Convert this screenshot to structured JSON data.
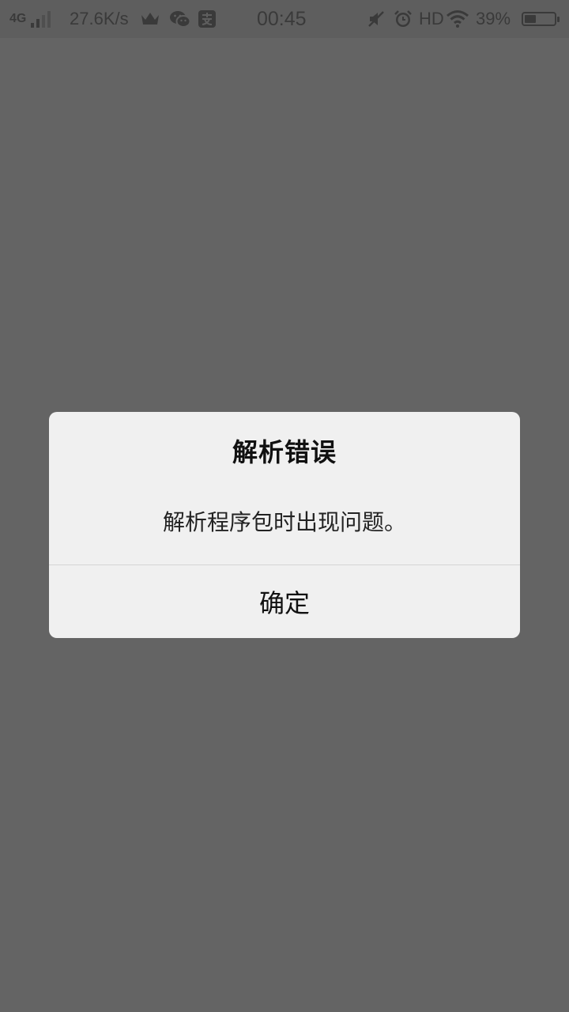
{
  "status_bar": {
    "network": "4G",
    "speed": "27.6K/s",
    "time": "00:45",
    "hd": "HD",
    "battery_percent": "39%",
    "battery_level": 0.39,
    "icons": [
      "signal-icon",
      "crown-icon",
      "wechat-icon",
      "alipay-icon",
      "mute-icon",
      "alarm-icon",
      "wifi-icon",
      "battery-icon"
    ]
  },
  "dialog": {
    "title": "解析错误",
    "message": "解析程序包时出现问题。",
    "confirm_label": "确定"
  }
}
